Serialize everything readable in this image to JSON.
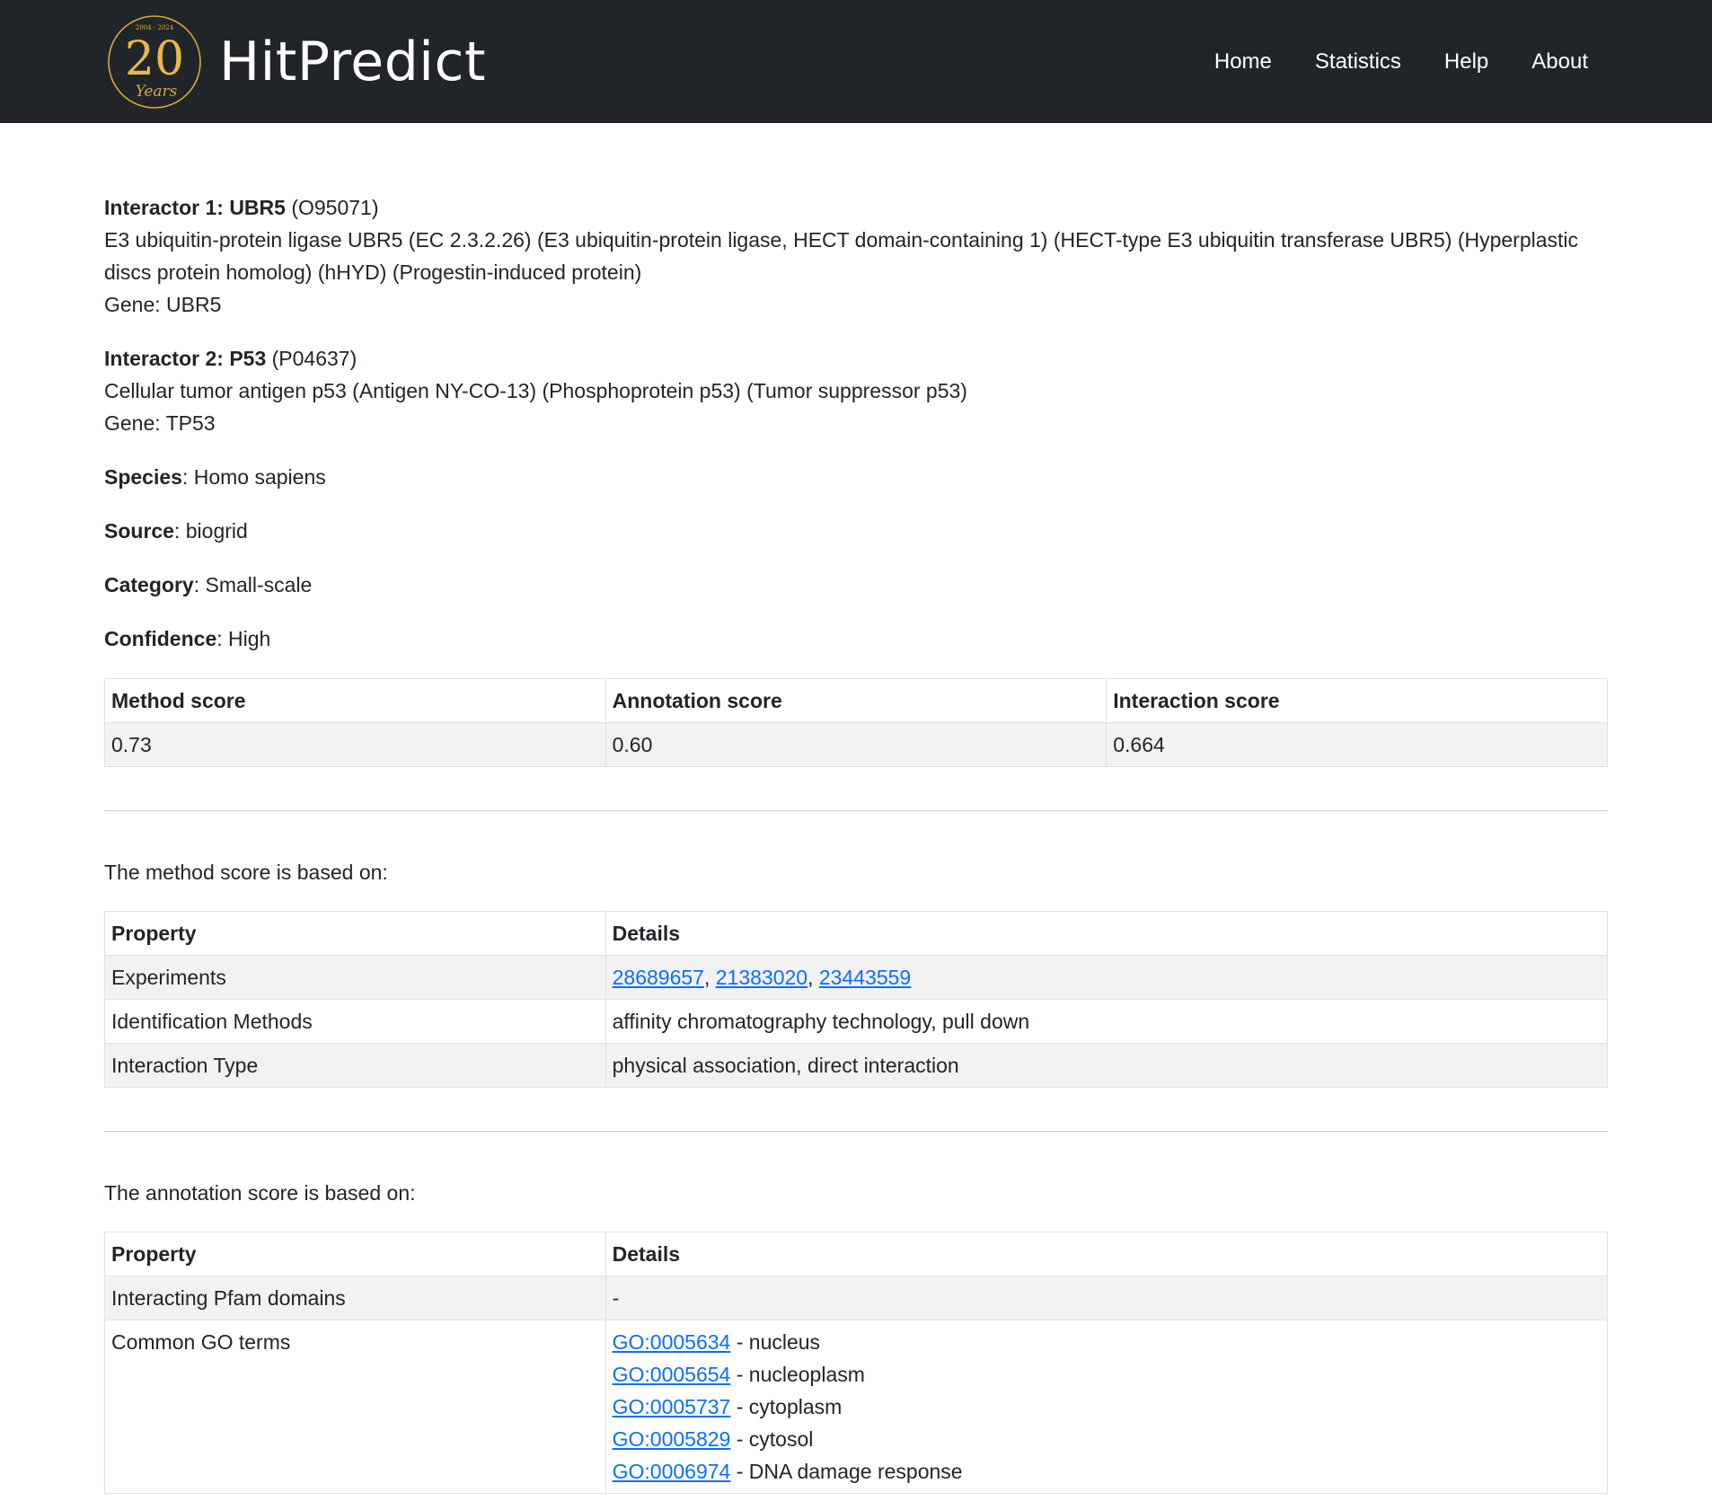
{
  "header": {
    "logo": {
      "years_range": "2004 - 2024",
      "number": "20",
      "word": "Years"
    },
    "brand": "HitPredict",
    "nav": [
      "Home",
      "Statistics",
      "Help",
      "About"
    ]
  },
  "interactor1": {
    "label": "Interactor 1: UBR5",
    "id": "(O95071)",
    "description": "E3 ubiquitin-protein ligase UBR5 (EC 2.3.2.26) (E3 ubiquitin-protein ligase, HECT domain-containing 1) (HECT-type E3 ubiquitin transferase UBR5) (Hyperplastic discs protein homolog) (hHYD) (Progestin-induced protein)",
    "gene": "Gene: UBR5"
  },
  "interactor2": {
    "label": "Interactor 2: P53",
    "id": "(P04637)",
    "description": "Cellular tumor antigen p53 (Antigen NY-CO-13) (Phosphoprotein p53) (Tumor suppressor p53)",
    "gene": "Gene: TP53"
  },
  "fields": {
    "species_label": "Species",
    "species_value": ": Homo sapiens",
    "source_label": "Source",
    "source_value": ": biogrid",
    "category_label": "Category",
    "category_value": ": Small-scale",
    "confidence_label": "Confidence",
    "confidence_value": ": High"
  },
  "scores": {
    "headers": [
      "Method score",
      "Annotation score",
      "Interaction score"
    ],
    "values": [
      "0.73",
      "0.60",
      "0.664"
    ]
  },
  "method_section": {
    "intro": "The method score is based on:",
    "headers": [
      "Property",
      "Details"
    ],
    "experiments_label": "Experiments",
    "experiments": [
      "28689657",
      "21383020",
      "23443559"
    ],
    "separator": ", ",
    "id_methods_label": "Identification Methods",
    "id_methods_value": "affinity chromatography technology, pull down",
    "interaction_type_label": "Interaction Type",
    "interaction_type_value": "physical association, direct interaction"
  },
  "annotation_section": {
    "intro": "The annotation score is based on:",
    "headers": [
      "Property",
      "Details"
    ],
    "pfam_label": "Interacting Pfam domains",
    "pfam_value": "-",
    "go_label": "Common GO terms",
    "go_terms": [
      {
        "id": "GO:0005634",
        "sep": " - ",
        "name": "nucleus"
      },
      {
        "id": "GO:0005654",
        "sep": " - ",
        "name": "nucleoplasm"
      },
      {
        "id": "GO:0005737",
        "sep": " - ",
        "name": "cytoplasm"
      },
      {
        "id": "GO:0005829",
        "sep": " - ",
        "name": "cytosol"
      },
      {
        "id": "GO:0006974",
        "sep": " - ",
        "name": "DNA damage response"
      }
    ]
  },
  "colors": {
    "navbar_bg": "#212529",
    "logo_gold": "#d4a93a",
    "link": "#0d6efd",
    "stripe": "#f2f2f2"
  }
}
